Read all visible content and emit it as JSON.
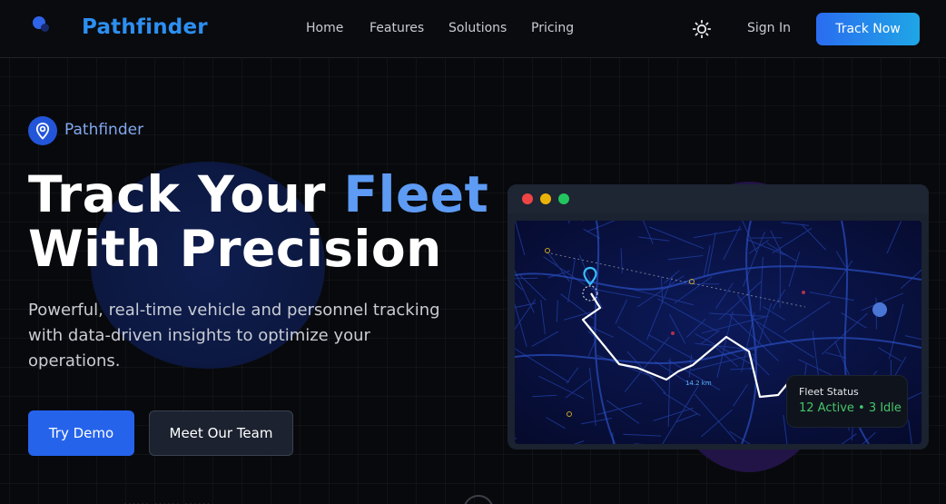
{
  "header": {
    "brand": "Pathfinder",
    "nav": [
      "Home",
      "Features",
      "Solutions",
      "Pricing"
    ],
    "theme_icon": "sun-icon",
    "sign_in": "Sign In",
    "cta": "Track Now"
  },
  "hero": {
    "badge_icon": "map-pin-icon",
    "badge_text": "Pathfinder",
    "headline_part1": "Track Your ",
    "headline_accent": "Fleet",
    "headline_line2": "With Precision",
    "subtext": "Powerful, real-time vehicle and personnel tracking with data-driven insights to optimize your operations.",
    "primary_button": "Try Demo",
    "secondary_button": "Meet Our Team",
    "below_fold_hint": "......  ......  ......"
  },
  "map": {
    "window_dots": [
      "#ef4444",
      "#eab308",
      "#22c55e"
    ],
    "distance_label": "14.2 km",
    "route_color": "#ffffff",
    "marker_color": "#38bdf8",
    "fleet_card": {
      "title": "Fleet Status",
      "status": "12 Active • 3 Idle"
    }
  },
  "colors": {
    "brand": "#2c8ff2",
    "accent": "#5d9bf4",
    "primary_button": "#2563eb",
    "active_status": "#46c46a"
  }
}
